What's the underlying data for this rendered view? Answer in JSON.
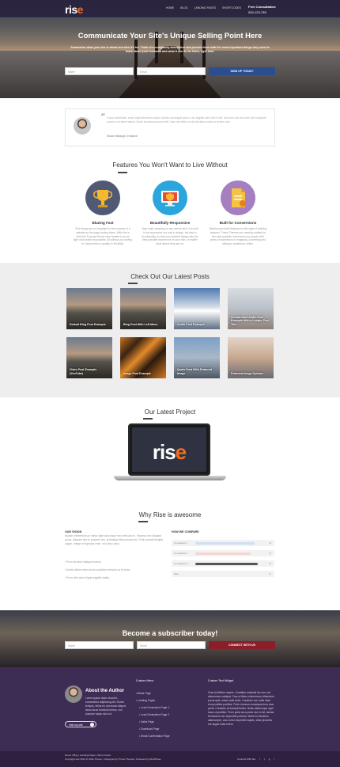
{
  "nav": {
    "logo_main": "ris",
    "logo_e": "e",
    "menu": [
      "HOME",
      "BLOG",
      "LANDING PAGES",
      "SHORTCODES"
    ],
    "consult_label": "Free Consultation:",
    "consult_phone": "000-123-789"
  },
  "hero": {
    "title": "Communicate Your Site's Unique Selling Point Here",
    "subtitle": "Summarize what your site is about and who it's for. Think of a completely new visitor and provide them with the most important things they need to know about your business and what it can do for them, right here.",
    "name_placeholder": "Name",
    "email_placeholder": "Email",
    "cta": "SIGN UP TODAY!"
  },
  "testimonial": {
    "quote": "Fusce sollicitudin, lorem eget bibendum auctor, lacinia consequat ipsum, nec sagittis sem nibh id elit. Duis sed odio sit amet nibh vulputate cursus a sit amet mauris. Morbi accumsan ipsum velit. Nam nec tellus a odio tincidunt auctor a ornare odio.",
    "author": "Shane Melaugh",
    "company": "Empirize"
  },
  "features": {
    "title": "Features You Won't Want to Live Without",
    "items": [
      {
        "title": "Blazing Fast",
        "text": "Five things are so important to the success of a website as the page loading times. With this in mind the Focused theme was created to be as light and nimble as possible, all without you having to compromise in quality or flexibility.",
        "color": "#515a75",
        "icon": "trophy-icon"
      },
      {
        "title": "Beautifully Responsive",
        "text": "Stop looks amazing on any screen size. It is built to be responsive not only in design, but also in functionality, so that your website always has the best possible experience on your site, no matter what device they are on.",
        "color": "#2aa6dd",
        "icon": "monitor-shield-icon"
      },
      {
        "title": "Built for Conversions",
        "text": "Mention just build features for the sake of building features. These Themes are carefully crafted for the best possible conversions by people with years of experience in engaging, converting and selling to audiences online.",
        "color": "#a57fc0",
        "icon": "document-icon"
      }
    ]
  },
  "posts": {
    "title": "Check Out Our Latest Posts",
    "items": [
      {
        "caption": "Default Blog Post Example",
        "scene": "pier"
      },
      {
        "caption": "Blog Post With Left Menu",
        "scene": "pier"
      },
      {
        "caption": "Audio Post Example",
        "scene": "mountain"
      },
      {
        "caption": "SoundCloud Audio Post Example With a Longer Post Title",
        "scene": "snow"
      },
      {
        "caption": "Video Post Example (YouTube)",
        "scene": "pier"
      },
      {
        "caption": "Image Post Example",
        "scene": "tiger"
      },
      {
        "caption": "Quote Post With Featured Image",
        "scene": "city"
      },
      {
        "caption": "Featured Image Options",
        "scene": "sunset"
      }
    ]
  },
  "project": {
    "title": "Our Latest Project",
    "logo_main": "ris",
    "logo_e": "e"
  },
  "why": {
    "title": "Why Rise is awesome",
    "vision_head": "OUR VISION",
    "vision_text": "Nullam elementum ac metus eget accumsan nec vehicula eu. Vivamus nec aliquam purus. Aliquam nisi ex posuere nisi, at tristique felis posuere ac. Proin laoreet fringilla augue, integer et egestas enim, vel luctus risus.",
    "bullets": [
      "Proin sit amet tristique mauris.",
      "Morbi ultrices diam at arcu porttitor vehicula ac et tortor.",
      "Proin nibh nisl et ligula sagittis mattis."
    ],
    "compare_head": "HOW WE COMPARE",
    "bars": [
      {
        "label": "Competitor 1",
        "value": 0.85,
        "color": "#cfe0f2"
      },
      {
        "label": "Competitor 2",
        "value": 0.8,
        "color": "#f2d7d0"
      },
      {
        "label": "Competitor 3",
        "value": 0.9,
        "color": "#555555"
      },
      {
        "label": "Rise",
        "value": 0.0,
        "color": "#cccccc"
      }
    ]
  },
  "subscribe": {
    "title": "Become a subscriber today!",
    "name_placeholder": "Name",
    "email_placeholder": "Email",
    "cta": "CONNECT WITH US"
  },
  "footer": {
    "about_title": "About the Author",
    "about_text": "Lorem ipsum dolor sit amet, consectetur adipiscing elit. Donec tempus, tellus eu commodo aliquet, lacus lacus tincidunt metus, non posuere turpis nisl a ut.",
    "visit_label": "Visit my site",
    "menu_head": "Custom Menu",
    "menu": [
      "Blank Page",
      "Landing Pages",
      "Lead Generation Page 1",
      "Lead Generation Page 2",
      "Sales Page",
      "Download Page",
      "Email Confirmation Page"
    ],
    "widget_head": "Custom Text Widget",
    "widget_text": "Cras id efficitur mauris. Curabitur molestie leo non orci elementum volutpat. Cras ut libero elementum, bibendum purus quis, metus adis tortor. Curabitur non nulla vitae eros porttitor porttitor. Proin rhoncus consequat eros arcu porta. Curabitur at suscipit lectus. Nulla ullamcorper eget lacus ut porttitor. Proin porta arcu porta nec in est, lacinia fermentum nec imperdiet pulvinar. Morbi eu faucibus ullamcorper, arcu tortor imperdiet sapien, vitae pharetra est augue vitae lorem.",
    "bottom_links": "Home | Blog | Landing Pages | Short Codes",
    "copyright": "Copyright text 2014 by Rise Theme. | Designed by Thrive Themes | Powered by WordPress",
    "connect_label": "Connect With Me"
  }
}
